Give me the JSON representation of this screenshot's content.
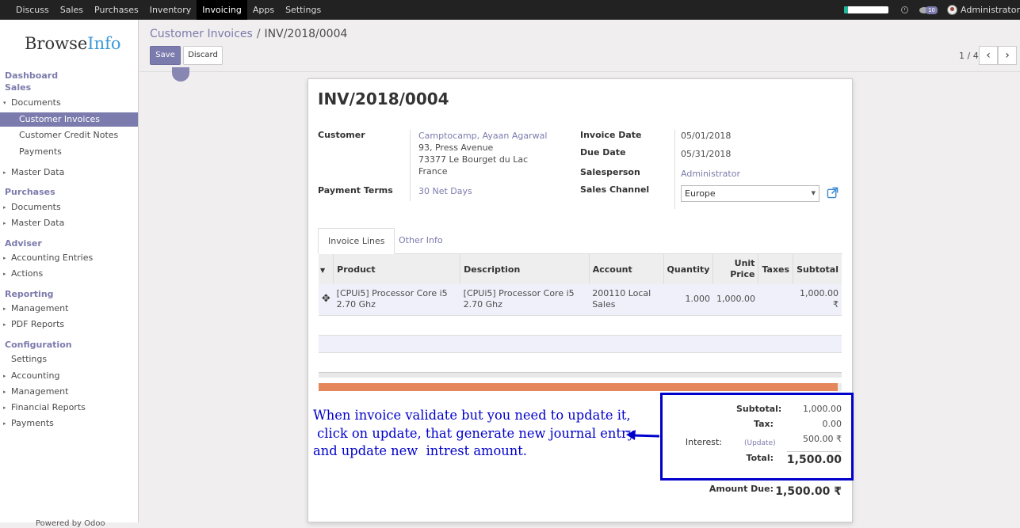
{
  "topbar": {
    "menu": [
      "Discuss",
      "Sales",
      "Purchases",
      "Inventory",
      "Invoicing",
      "Apps",
      "Settings"
    ],
    "active_index": 4,
    "progress_fraction": 0.08,
    "chat_count": "10",
    "username": "Administrator"
  },
  "sidebar": {
    "logo_browse": "Browse",
    "logo_info": "Info",
    "dashboard": "Dashboard",
    "sales": "Sales",
    "sales_documents": "Documents",
    "customer_invoices": "Customer Invoices",
    "customer_credit_notes": "Customer Credit Notes",
    "payments": "Payments",
    "sales_master_data": "Master Data",
    "purchases": "Purchases",
    "purchases_documents": "Documents",
    "purchases_master_data": "Master Data",
    "adviser": "Adviser",
    "accounting_entries": "Accounting Entries",
    "actions": "Actions",
    "reporting": "Reporting",
    "reporting_management": "Management",
    "pdf_reports": "PDF Reports",
    "configuration": "Configuration",
    "settings": "Settings",
    "accounting": "Accounting",
    "config_management": "Management",
    "financial_reports": "Financial Reports",
    "config_payments": "Payments",
    "footer": "Powered by Odoo"
  },
  "breadcrumb": {
    "parent": "Customer Invoices",
    "separator": "/",
    "current": "INV/2018/0004"
  },
  "buttons": {
    "save": "Save",
    "discard": "Discard"
  },
  "pager": {
    "text": "1 / 4",
    "prev": "‹",
    "next": "›"
  },
  "invoice": {
    "number": "INV/2018/0004",
    "customer_label": "Customer",
    "customer_name": "Camptocamp, Ayaan Agarwal",
    "address_1": "93, Press Avenue",
    "address_2": "73377 Le Bourget du Lac",
    "address_3": "France",
    "payment_terms_label": "Payment Terms",
    "payment_terms": "30 Net Days",
    "invoice_date_label": "Invoice Date",
    "invoice_date": "05/01/2018",
    "due_date_label": "Due Date",
    "due_date": "05/31/2018",
    "salesperson_label": "Salesperson",
    "salesperson": "Administrator",
    "sales_channel_label": "Sales Channel",
    "sales_channel": "Europe"
  },
  "tabs": {
    "invoice_lines": "Invoice Lines",
    "other_info": "Other Info"
  },
  "lines": {
    "headers": {
      "product": "Product",
      "description": "Description",
      "account": "Account",
      "quantity": "Quantity",
      "unit_price_1": "Unit",
      "unit_price_2": "Price",
      "taxes": "Taxes",
      "subtotal": "Subtotal"
    },
    "rows": [
      {
        "product": "[CPUi5] Processor Core i5 2.70 Ghz",
        "description": "[CPUi5] Processor Core i5 2.70 Ghz",
        "account": "200110 Local Sales",
        "quantity": "1.000",
        "unit_price": "1,000.00",
        "taxes": "",
        "subtotal": "1,000.00 ₹"
      }
    ]
  },
  "payment_progress_fraction": 0.993,
  "totals": {
    "subtotal_label": "Subtotal:",
    "subtotal": "1,000.00",
    "tax_label": "Tax:",
    "tax": "0.00",
    "interest_label": "Interest:",
    "update_link": "(Update)",
    "interest": "500.00 ₹",
    "total_label": "Total:",
    "total": "1,500.00",
    "amount_due_label": "Amount Due:",
    "amount_due": "1,500.00 ₹"
  },
  "annotation": {
    "line1": "When invoice validate but you need to update it,",
    "line2": " click on update, that generate new journal entry",
    "line3": "and update new  intrest amount."
  },
  "colors": {
    "accent": "#7c7bad",
    "topbar": "#222222",
    "annotation_blue": "#0000cc",
    "progress_orange": "#e4875d"
  }
}
